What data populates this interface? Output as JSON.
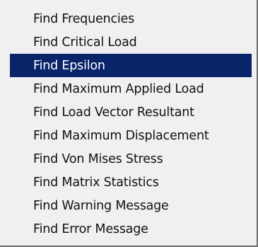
{
  "menu": {
    "selected_index": 2,
    "items": [
      {
        "label": "Find Frequencies"
      },
      {
        "label": "Find Critical Load"
      },
      {
        "label": "Find Epsilon"
      },
      {
        "label": "Find Maximum Applied Load"
      },
      {
        "label": "Find Load Vector Resultant"
      },
      {
        "label": "Find Maximum Displacement"
      },
      {
        "label": "Find Von Mises Stress"
      },
      {
        "label": "Find Matrix Statistics"
      },
      {
        "label": "Find Warning Message"
      },
      {
        "label": "Find Error Message"
      }
    ]
  },
  "colors": {
    "menu_background": "#f0f0f0",
    "highlight_background": "#0a246a",
    "highlight_text": "#ffffff",
    "text": "#111111",
    "shadow_border": "#6e6e6e"
  }
}
